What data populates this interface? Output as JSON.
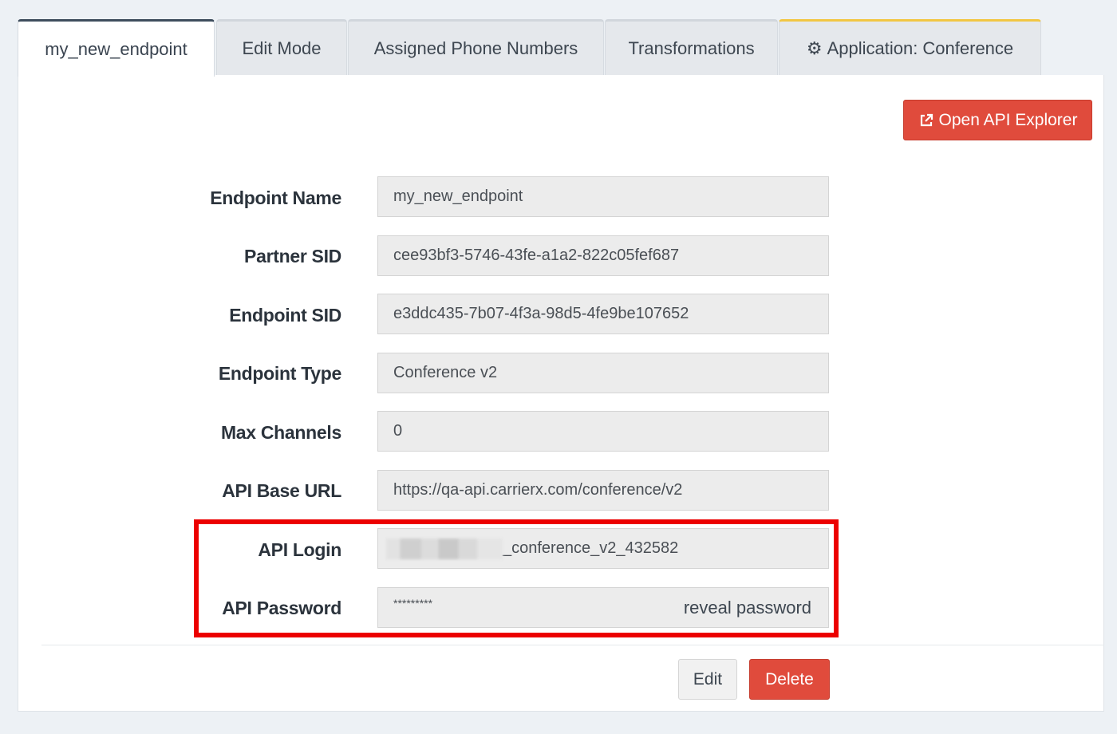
{
  "tabs": [
    {
      "label": "my_new_endpoint"
    },
    {
      "label": "Edit Mode"
    },
    {
      "label": "Assigned Phone Numbers"
    },
    {
      "label": "Transformations"
    },
    {
      "label": "Application: Conference",
      "icon": "gear-icon"
    }
  ],
  "toolbar": {
    "api_explorer_label": "Open API Explorer",
    "api_explorer_icon": "external-link-icon"
  },
  "fields": {
    "endpoint_name": {
      "label": "Endpoint Name",
      "value": "my_new_endpoint"
    },
    "partner_sid": {
      "label": "Partner SID",
      "value": "cee93bf3-5746-43fe-a1a2-822c05fef687"
    },
    "endpoint_sid": {
      "label": "Endpoint SID",
      "value": "e3ddc435-7b07-4f3a-98d5-4fe9be107652"
    },
    "endpoint_type": {
      "label": "Endpoint Type",
      "value": "Conference v2"
    },
    "max_channels": {
      "label": "Max Channels",
      "value": "0"
    },
    "api_base_url": {
      "label": "API Base URL",
      "value": "https://qa-api.carrierx.com/conference/v2"
    },
    "api_login": {
      "label": "API Login",
      "value": "_conference_v2_432582"
    },
    "api_password": {
      "label": "API Password",
      "value": "*********",
      "reveal_label": "reveal password"
    }
  },
  "actions": {
    "edit_label": "Edit",
    "delete_label": "Delete"
  },
  "colors": {
    "danger": "#e04b3c",
    "highlight": "#ec0000",
    "accent_tab": "#f2c744"
  }
}
